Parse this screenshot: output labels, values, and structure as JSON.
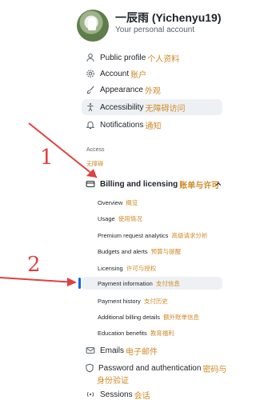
{
  "account": {
    "display_name": "一辰雨 (Yichenyu19)",
    "subtitle": "Your personal account"
  },
  "nav_top": [
    {
      "label": "Public profile",
      "cn": "个人资料",
      "icon": "person-icon"
    },
    {
      "label": "Account",
      "cn": "账户",
      "icon": "gear-icon"
    },
    {
      "label": "Appearance",
      "cn": "外观",
      "icon": "paintbrush-icon"
    },
    {
      "label": "Accessibility",
      "cn": "无障碍访问",
      "icon": "accessibility-icon"
    },
    {
      "label": "Notifications",
      "cn": "通知",
      "icon": "bell-icon"
    }
  ],
  "access_section": {
    "label": "Access",
    "cn": "无障碍"
  },
  "billing": {
    "label": "Billing and licensing",
    "cn": "账单与许可",
    "items": [
      {
        "label": "Overview",
        "cn": "概览"
      },
      {
        "label": "Usage",
        "cn": "使用情况"
      },
      {
        "label": "Premium request analytics",
        "cn": "高级请求分析"
      },
      {
        "label": "Budgets and alerts",
        "cn": "预算与提醒"
      },
      {
        "label": "Licensing",
        "cn": "许可与授权"
      },
      {
        "label": "Payment information",
        "cn": "支付信息"
      },
      {
        "label": "Payment history",
        "cn": "支付历史"
      },
      {
        "label": "Additional billing details",
        "cn": "额外账单信息"
      },
      {
        "label": "Education benefits",
        "cn": "教育福利"
      }
    ]
  },
  "nav_bottom": [
    {
      "label": "Emails",
      "cn": "电子邮件",
      "icon": "mail-icon"
    },
    {
      "label": "Password and authentication",
      "cn": "密码与",
      "cn2": "身份验证",
      "icon": "shield-icon"
    },
    {
      "label": "Sessions",
      "cn": "会话",
      "icon": "broadcast-icon"
    }
  ],
  "annotations": {
    "arrow1_number": "1",
    "arrow2_number": "2"
  },
  "colors": {
    "accent_cn": "#d08a26",
    "active_indicator": "#0969da",
    "annotation": "#e04040"
  }
}
